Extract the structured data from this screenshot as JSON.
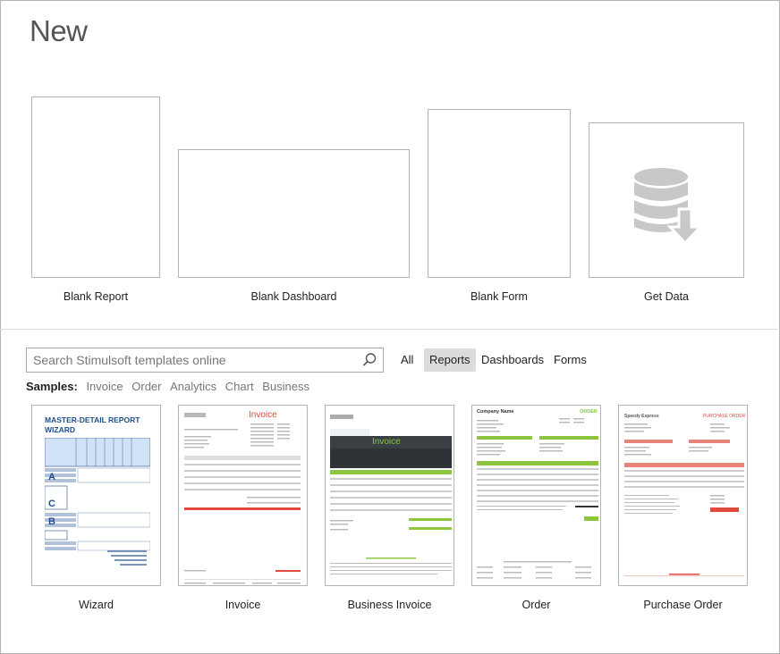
{
  "page": {
    "title": "New"
  },
  "templates": [
    {
      "label": "Blank Report"
    },
    {
      "label": "Blank Dashboard"
    },
    {
      "label": "Blank Form"
    },
    {
      "label": "Get Data"
    }
  ],
  "search": {
    "placeholder": "Search Stimulsoft templates online"
  },
  "filters": [
    "All",
    "Reports",
    "Dashboards",
    "Forms"
  ],
  "active_filter": "Reports",
  "samples": {
    "label": "Samples:",
    "categories": [
      "Invoice",
      "Order",
      "Analytics",
      "Chart",
      "Business"
    ]
  },
  "thumbnails": [
    {
      "label": "Wizard",
      "caption": "MASTER-DETAIL REPORT WIZARD",
      "letters": [
        "A",
        "B",
        "C"
      ]
    },
    {
      "label": "Invoice",
      "caption": "Invoice"
    },
    {
      "label": "Business Invoice",
      "caption": "Invoice"
    },
    {
      "label": "Order",
      "caption": "ORDER",
      "company": "Company Name"
    },
    {
      "label": "Purchase Order",
      "caption": "PURCHASE ORDER",
      "company": "Speedy Express"
    }
  ],
  "colors": {
    "frame": "#b4b4b4",
    "accent_blue": "#1f4e8c",
    "invoice_red": "#e04a3f",
    "order_green": "#8cc63f",
    "dark": "#3a3f44",
    "icon_gray": "#c8c8c8"
  }
}
